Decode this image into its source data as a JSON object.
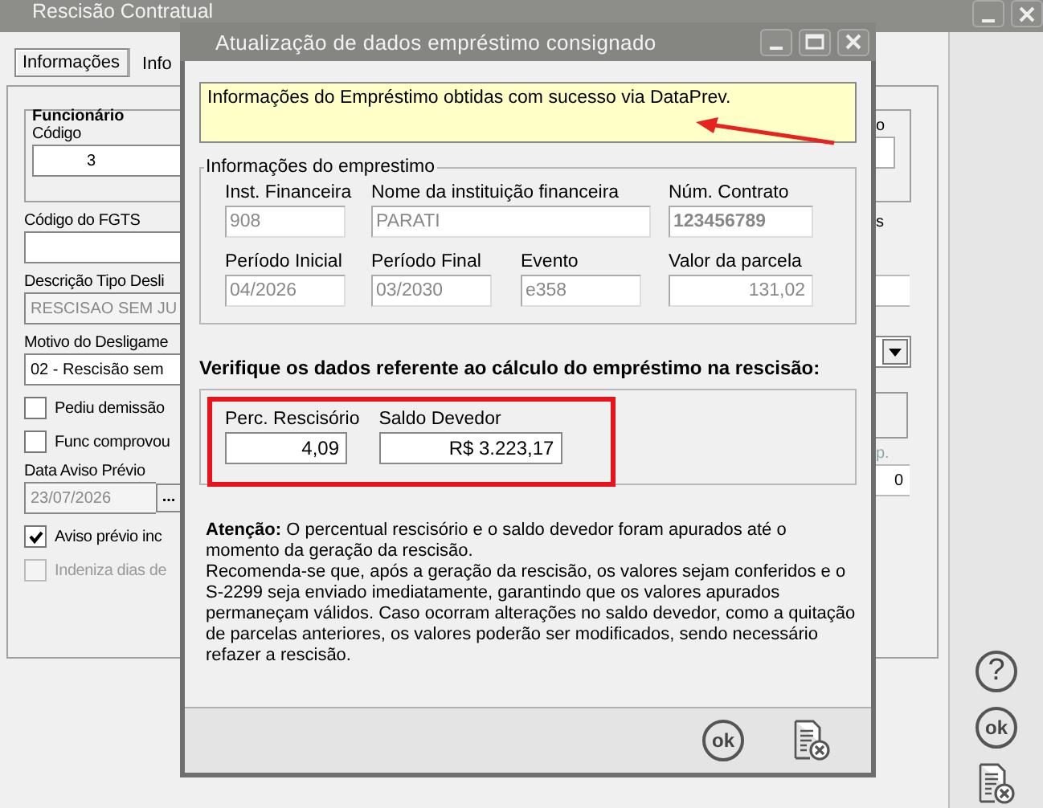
{
  "window": {
    "title": "Rescisão Contratual"
  },
  "tabs": [
    {
      "label": "Informações",
      "selected": true
    },
    {
      "label": "Info",
      "selected": false
    }
  ],
  "employee_group": {
    "title": "Funcionário",
    "code_label": "Código",
    "code_value": "3"
  },
  "form": [
    {
      "kind": "field",
      "label": "Código do FGTS"
    },
    {
      "kind": "field",
      "label": "Descrição Tipo Desli",
      "value": "RESCISAO SEM JU",
      "disabled": true
    },
    {
      "kind": "field",
      "label": "Motivo do Desligame",
      "value": "02 - Rescisão sem",
      "disabled": false
    },
    {
      "kind": "checkbox",
      "label": "Pediu demissão",
      "checked": false,
      "disabled": false
    },
    {
      "kind": "checkbox",
      "label": "Func comprovou",
      "checked": false,
      "disabled": false
    },
    {
      "kind": "date",
      "label": "Data Aviso Prévio",
      "value": "23/07/2026",
      "button": "...",
      "disabled": true
    },
    {
      "kind": "checkbox",
      "label": "Aviso prévio inc",
      "checked": true,
      "disabled": false
    },
    {
      "kind": "checkbox",
      "label": "Indeniza dias de",
      "checked": false,
      "disabled": true
    }
  ],
  "right_edge": {
    "texts": [
      "o",
      "s",
      "p."
    ],
    "field_value": "0"
  },
  "sidebar": {
    "buttons": [
      {
        "kind": "help",
        "label": "?"
      },
      {
        "kind": "ok",
        "label": "ok"
      },
      {
        "kind": "cancel"
      }
    ]
  },
  "dialog": {
    "title": "Atualização de dados empréstimo consignado",
    "message": "Informações do Empréstimo obtidas com sucesso via DataPrev.",
    "loan_group": {
      "title": "Informações do emprestimo",
      "fields": [
        {
          "label": "Inst. Financeira",
          "value": "908",
          "bold": false
        },
        {
          "label": "Nome da instituição financeira",
          "value": "PARATI",
          "bold": false
        },
        {
          "label": "Núm. Contrato",
          "value": "123456789",
          "bold": true
        },
        {
          "label": "Período Inicial",
          "value": "04/2026",
          "bold": false
        },
        {
          "label": "Período Final",
          "value": "03/2030",
          "bold": false
        },
        {
          "label": "Evento",
          "value": "e358",
          "bold": false
        },
        {
          "label": "Valor da parcela",
          "value": "131,02",
          "bold": false
        }
      ]
    },
    "verify_heading": "Verifique os dados referente ao cálculo do empréstimo na rescisão:",
    "calc_fields": [
      {
        "label": "Perc. Rescisório",
        "value": "4,09"
      },
      {
        "label": "Saldo Devedor",
        "value": "R$ 3.223,17"
      }
    ],
    "notice": [
      "**Atenção:** O percentual rescisório e o saldo devedor foram apurados até o momento da geração da rescisão.",
      "Recomenda-se que, após a geração da rescisão, os valores sejam conferidos e o S-2299 seja enviado imediatamente, garantindo que os valores apurados permaneçam válidos. Caso ocorram alterações no saldo devedor, como a quitação de parcelas anteriores, os valores poderão ser modificados, sendo necessário refazer a rescisão."
    ],
    "buttons": [
      {
        "kind": "ok",
        "label": "ok"
      },
      {
        "kind": "cancel"
      }
    ]
  }
}
